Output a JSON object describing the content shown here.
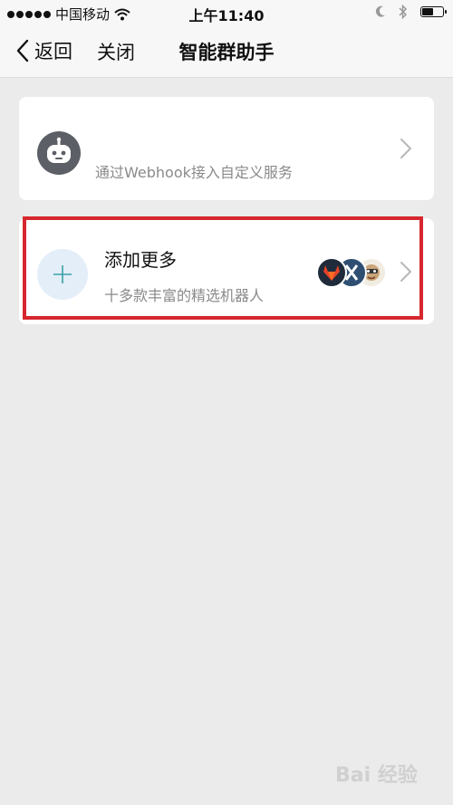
{
  "status_bar": {
    "carrier": "中国移动",
    "time": "上午11:40"
  },
  "nav": {
    "back_label": "返回",
    "close_label": "关闭",
    "title": "智能群助手"
  },
  "webhook_card": {
    "subtitle": "通过Webhook接入自定义服务",
    "icon": "robot-icon"
  },
  "more_card": {
    "title": "添加更多",
    "subtitle": "十多款丰富的精选机器人",
    "icon": "plus-icon",
    "avatars": [
      "gitlab-avatar",
      "jenkins-avatar",
      "bot-avatar"
    ]
  },
  "watermark": {
    "text": "Bai 经验"
  },
  "colors": {
    "highlight": "#d6262e",
    "background": "#ebebeb",
    "accent": "#3aa0a8"
  }
}
